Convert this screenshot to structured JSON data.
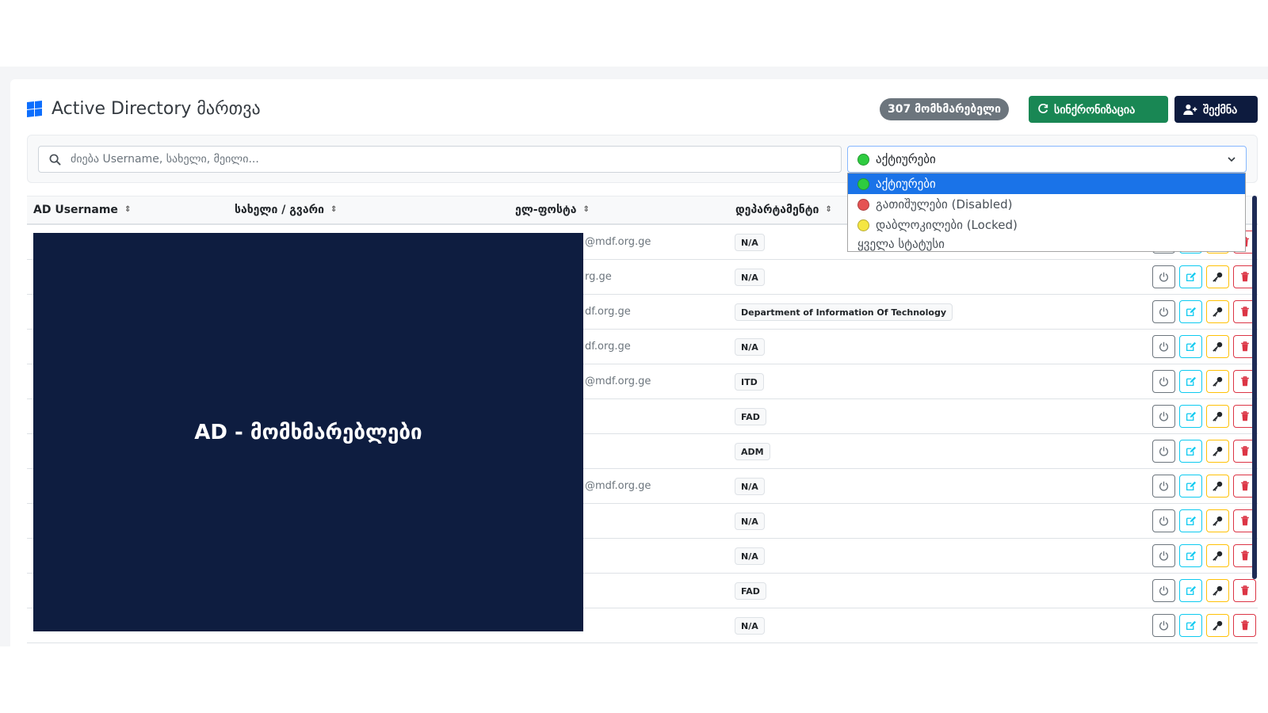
{
  "header": {
    "title": "Active Directory მართვა",
    "user_count": "307 მომხმარებელი",
    "sync_label": "სინქრონიზაცია",
    "create_label": "შექმნა"
  },
  "filters": {
    "search_placeholder": "ძიება Username, სახელი, მეილი...",
    "status_selected": "აქტიურები",
    "status_options": [
      {
        "label": "აქტიურები",
        "color": "#2ecc40"
      },
      {
        "label": "გათიშულები (Disabled)",
        "color": "#e55353"
      },
      {
        "label": "დაბლოკილები (Locked)",
        "color": "#f5e642"
      },
      {
        "label": "ყველა სტატუსი",
        "color": ""
      }
    ]
  },
  "table": {
    "columns": [
      "AD Username",
      "სახელი / გვარი",
      "ელ-ფოსტა",
      "დეპარტამენტი"
    ],
    "rows": [
      {
        "email": "@mdf.org.ge",
        "dept": "N/A"
      },
      {
        "email": "rg.ge",
        "dept": "N/A"
      },
      {
        "email": "df.org.ge",
        "dept": "Department of Information Of Technology"
      },
      {
        "email": "df.org.ge",
        "dept": "N/A"
      },
      {
        "email": "@mdf.org.ge",
        "dept": "ITD"
      },
      {
        "email": "",
        "dept": "FAD"
      },
      {
        "email": "",
        "dept": "ADM"
      },
      {
        "email": "@mdf.org.ge",
        "dept": "N/A"
      },
      {
        "email": "",
        "dept": "N/A"
      },
      {
        "email": "",
        "dept": "N/A"
      },
      {
        "email": "",
        "dept": "FAD"
      },
      {
        "email": "",
        "dept": "N/A"
      }
    ]
  },
  "overlay": {
    "text": "AD - მომხმარებლები"
  },
  "colors": {
    "primary_dark": "#0d1b3e",
    "success": "#198754",
    "overlay_bg": "#0e1d40"
  }
}
